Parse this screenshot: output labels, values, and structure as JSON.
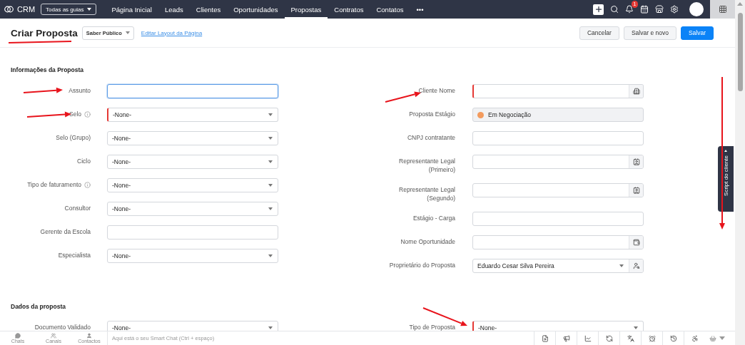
{
  "nav": {
    "logo": "CRM",
    "all_tabs": "Todas as guias",
    "tabs": [
      {
        "label": "Página Inicial",
        "selected": false
      },
      {
        "label": "Leads",
        "selected": false
      },
      {
        "label": "Clientes",
        "selected": false
      },
      {
        "label": "Oportunidades",
        "selected": false
      },
      {
        "label": "Propostas",
        "selected": true
      },
      {
        "label": "Contratos",
        "selected": false
      },
      {
        "label": "Contatos",
        "selected": false
      }
    ],
    "more": "•••",
    "notification_count": "1"
  },
  "header": {
    "title": "Criar Proposta",
    "layout": "Saber Público",
    "edit_link": "Editar Layout da Página",
    "buttons": [
      {
        "label": "Cancelar",
        "kind": "secondary"
      },
      {
        "label": "Salvar e novo",
        "kind": "secondary"
      },
      {
        "label": "Salvar",
        "kind": "primary"
      }
    ]
  },
  "sections": [
    {
      "title": "Informações da Proposta",
      "left": [
        {
          "label": "Assunto",
          "kind": "text",
          "required": false,
          "focused": true,
          "info": false
        },
        {
          "label": "Selo",
          "kind": "select",
          "value": "-None-",
          "required": true,
          "focused": false,
          "info": true
        },
        {
          "label": "Selo (Grupo)",
          "kind": "select",
          "value": "-None-",
          "required": false,
          "focused": false,
          "info": false
        },
        {
          "label": "Ciclo",
          "kind": "select",
          "value": "-None-",
          "required": false,
          "focused": false,
          "info": false
        },
        {
          "label": "Tipo de faturamento",
          "kind": "select",
          "value": "-None-",
          "required": false,
          "focused": false,
          "info": true
        },
        {
          "label": "Consultor",
          "kind": "select",
          "value": "-None-",
          "required": false,
          "focused": false,
          "info": false
        },
        {
          "label": "Gerente da Escola",
          "kind": "text",
          "required": false,
          "focused": false,
          "info": false
        },
        {
          "label": "Especialista",
          "kind": "select",
          "value": "-None-",
          "required": false,
          "focused": false,
          "info": false
        }
      ],
      "right": [
        {
          "label": "Cliente Nome",
          "kind": "account_lookup",
          "required": true,
          "focused": false,
          "info": false
        },
        {
          "label": "Proposta Estágio",
          "kind": "stage",
          "value": "Em Negociação",
          "required": false,
          "focused": false,
          "info": false
        },
        {
          "label": "CNPJ contratante",
          "kind": "text",
          "required": false,
          "focused": false,
          "info": false
        },
        {
          "label": "Representante Legal (Primeiro)",
          "kind": "contact_lookup",
          "required": false,
          "focused": false,
          "info": false
        },
        {
          "label": "Representante Legal (Segundo)",
          "kind": "contact_lookup",
          "required": false,
          "focused": false,
          "info": false
        },
        {
          "label": "Estágio - Carga",
          "kind": "text",
          "required": false,
          "focused": false,
          "info": false
        },
        {
          "label": "Nome Oportunidade",
          "kind": "deal_lookup",
          "required": false,
          "focused": false,
          "info": false
        },
        {
          "label": "Proprietário do Proposta",
          "kind": "owner",
          "value": "Eduardo Cesar Silva Pereira",
          "required": false,
          "focused": false,
          "info": false
        }
      ]
    },
    {
      "title": "Dados da proposta",
      "left": [
        {
          "label": "Documento Validado",
          "kind": "select",
          "value": "-None-",
          "required": false,
          "focused": false,
          "info": false
        }
      ],
      "right": [
        {
          "label": "Tipo de Proposta",
          "kind": "select",
          "value": "-None-",
          "required": true,
          "focused": false,
          "info": false
        }
      ]
    }
  ],
  "side_tab": "Script do cliente",
  "bottom": {
    "chat_tabs": [
      "Chats",
      "Canais",
      "Contactos"
    ],
    "smart_chat_placeholder": "Aqui está o seu Smart Chat (Ctrl + espaço)"
  }
}
